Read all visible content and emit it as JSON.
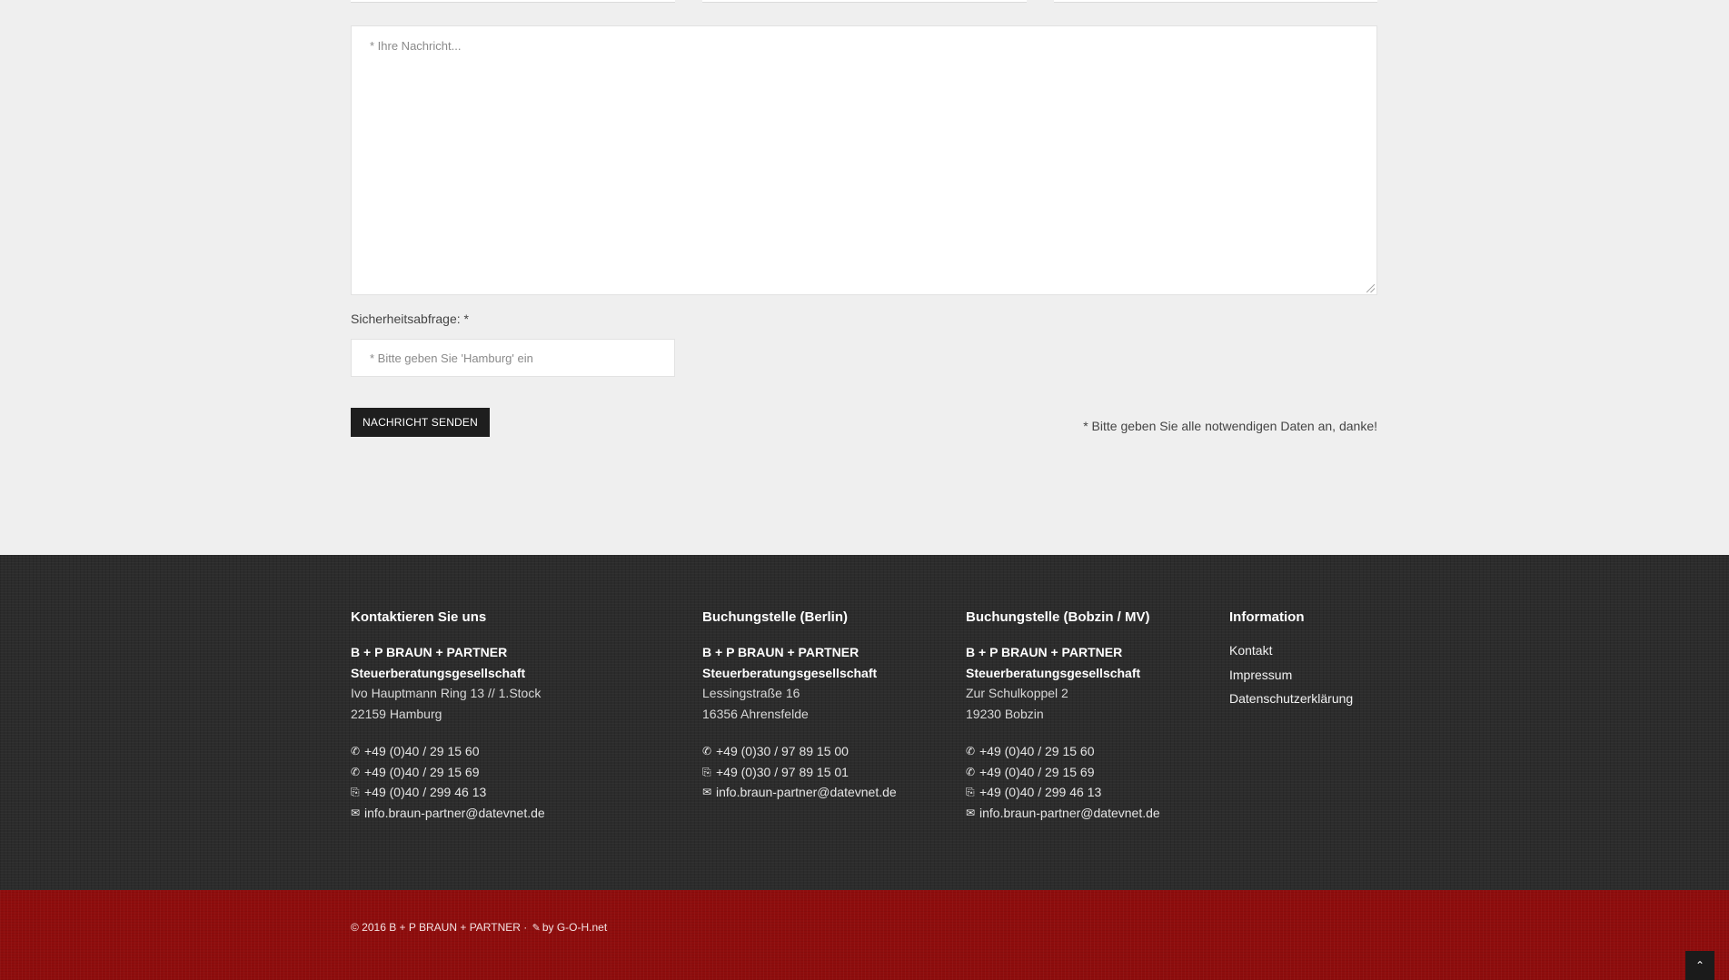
{
  "form": {
    "message_placeholder": "* Ihre Nachricht...",
    "captcha_label": "Sicherheitsabfrage: *",
    "captcha_placeholder": "* Bitte geben Sie 'Hamburg' ein",
    "submit_label": "NACHRICHT SENDEN",
    "required_note": "* Bitte geben Sie alle notwendigen Daten an, danke!"
  },
  "footer": {
    "col1": {
      "title": "Kontaktieren Sie uns",
      "company_line1": "B + P BRAUN + PARTNER",
      "company_line2": "Steuerberatungsgesellschaft",
      "street": "Ivo Hauptmann Ring 13 // 1.Stock",
      "city": "22159 Hamburg",
      "phone1": "+49 (0)40 / 29 15 60",
      "phone2": "+49 (0)40 / 29 15 69",
      "fax": "+49 (0)40 / 299 46 13",
      "email": "info.braun-partner@datevnet.de"
    },
    "col2": {
      "title": "Buchungstelle (Berlin)",
      "company_line1": "B + P BRAUN + PARTNER",
      "company_line2": "Steuerberatungsgesellschaft",
      "street": "Lessingstraße 16",
      "city": "16356 Ahrensfelde",
      "phone1": "+49 (0)30 / 97 89 15 00",
      "fax": "+49 (0)30 / 97 89 15 01",
      "email": "info.braun-partner@datevnet.de"
    },
    "col3": {
      "title": "Buchungstelle (Bobzin / MV)",
      "company_line1": "B + P BRAUN + PARTNER",
      "company_line2": "Steuerberatungsgesellschaft",
      "street": "Zur Schulkoppel 2",
      "city": "19230 Bobzin",
      "phone1": "+49 (0)40 / 29 15 60",
      "phone2": "+49 (0)40 / 29 15 69",
      "fax": "+49 (0)40 / 299 46 13",
      "email": "info.braun-partner@datevnet.de"
    },
    "info": {
      "title": "Information",
      "links": [
        "Kontakt",
        "Impressum",
        "Datenschutzerklärung"
      ]
    },
    "copyright": "© 2016 B + P BRAUN + PARTNER ·",
    "credit": "by G-O-H.net"
  },
  "icons": {
    "phone": "phone-icon",
    "fax": "fax-icon",
    "email": "envelope-icon",
    "edit": "edit-icon",
    "scroll_top": "chevron-up-icon"
  },
  "colors": {
    "page_bg": "#efefef",
    "footer_bg": "#2c2c2c",
    "bottom_bar_bg": "#8f0d0d",
    "button_bg": "#1e1e1e"
  }
}
